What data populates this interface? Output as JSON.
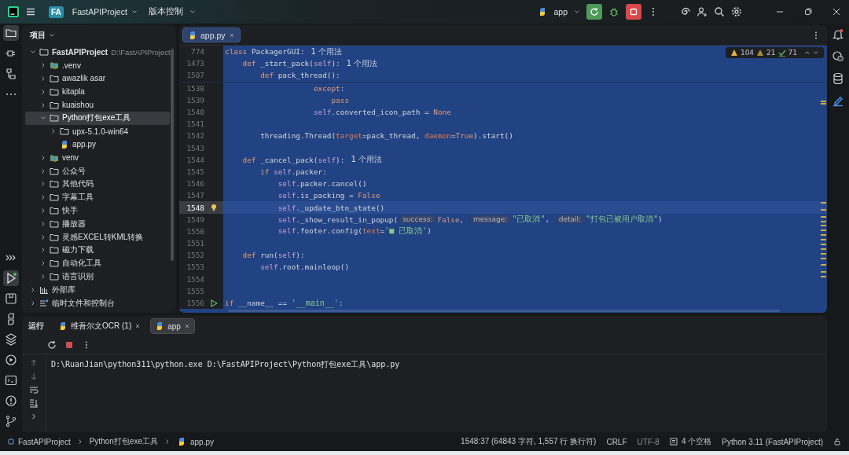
{
  "app": {
    "logo": "FA",
    "project": "FastAPIProject",
    "vcs": "版本控制",
    "run_config": "app"
  },
  "project": {
    "title": "项目",
    "tree": [
      {
        "name": "FastAPIProject",
        "path": "D:\\FastAPIProject",
        "kind": "folder",
        "expanded": true,
        "selected": false,
        "children": [
          {
            "name": ".venv",
            "kind": "venv",
            "expanded": false,
            "selected": false
          },
          {
            "name": "awazlik asar",
            "kind": "folder",
            "expanded": false,
            "selected": false
          },
          {
            "name": "kitapla",
            "kind": "folder",
            "expanded": false,
            "selected": false
          },
          {
            "name": "kuaishou",
            "kind": "folder",
            "expanded": false,
            "selected": false
          },
          {
            "name": "Python打包exe工具",
            "kind": "folder",
            "expanded": true,
            "selected": true,
            "children": [
              {
                "name": "upx-5.1.0-win64",
                "kind": "folder",
                "expanded": false,
                "selected": false
              },
              {
                "name": "app.py",
                "kind": "python",
                "selected": false
              }
            ]
          },
          {
            "name": "venv",
            "kind": "venv",
            "expanded": false,
            "selected": false
          },
          {
            "name": "公众号",
            "kind": "folder",
            "expanded": false,
            "selected": false
          },
          {
            "name": "其他代码",
            "kind": "folder",
            "expanded": false,
            "selected": false
          },
          {
            "name": "字幕工具",
            "kind": "folder",
            "expanded": false,
            "selected": false
          },
          {
            "name": "快手",
            "kind": "folder",
            "expanded": false,
            "selected": false
          },
          {
            "name": "播放器",
            "kind": "folder",
            "expanded": false,
            "selected": false
          },
          {
            "name": "灵感EXCEL转KML转换",
            "kind": "folder",
            "expanded": false,
            "selected": false
          },
          {
            "name": "磁力下载",
            "kind": "folder",
            "expanded": false,
            "selected": false
          },
          {
            "name": "自动化工具",
            "kind": "folder",
            "expanded": false,
            "selected": false
          },
          {
            "name": "语言识别",
            "kind": "folder",
            "expanded": false,
            "selected": false
          }
        ]
      },
      {
        "name": "外部库",
        "kind": "library",
        "expanded": false,
        "selected": false
      },
      {
        "name": "临时文件和控制台",
        "kind": "scratch",
        "expanded": false,
        "selected": false
      }
    ]
  },
  "editor": {
    "tabs": [
      {
        "label": "app.py",
        "selected": true
      }
    ],
    "inspections": {
      "warnings": "104",
      "weak_warnings": "21",
      "typos": "71"
    },
    "sticky_lines": [
      {
        "no": "774",
        "current": false,
        "tokens": [
          {
            "kind": "keyword",
            "text": "class "
          },
          {
            "kind": "plain",
            "text": "PackagerGUI:"
          },
          {
            "kind": "usage",
            "text": "1 个用法"
          }
        ]
      },
      {
        "no": "1473",
        "current": false,
        "tokens": [
          {
            "kind": "keyword",
            "text": "    def "
          },
          {
            "kind": "plain",
            "text": "_start_pack("
          },
          {
            "kind": "self",
            "text": "self"
          },
          {
            "kind": "plain",
            "text": "):"
          },
          {
            "kind": "usage",
            "text": "1 个用法"
          }
        ]
      },
      {
        "no": "1507",
        "current": false,
        "tokens": [
          {
            "kind": "keyword",
            "text": "        def "
          },
          {
            "kind": "plain",
            "text": "pack_thread():"
          }
        ]
      }
    ],
    "lines": [
      {
        "no": "1538",
        "current": false,
        "tokens": [
          {
            "kind": "keyword",
            "text": "                    except"
          },
          {
            "kind": "plain",
            "text": ":"
          }
        ]
      },
      {
        "no": "1539",
        "current": false,
        "tokens": [
          {
            "kind": "keyword",
            "text": "                        pass"
          }
        ]
      },
      {
        "no": "1540",
        "current": false,
        "tokens": [
          {
            "kind": "self",
            "text": "                    self"
          },
          {
            "kind": "plain",
            "text": ".converted_icon_path = "
          },
          {
            "kind": "keyword",
            "text": "None"
          }
        ]
      },
      {
        "no": "1541",
        "current": false
      },
      {
        "no": "1542",
        "current": false,
        "tokens": [
          {
            "kind": "plain",
            "text": "        threading.Thread("
          },
          {
            "kind": "param",
            "text": "target"
          },
          {
            "kind": "plain",
            "text": "=pack_thread, "
          },
          {
            "kind": "param",
            "text": "daemon"
          },
          {
            "kind": "plain",
            "text": "="
          },
          {
            "kind": "keyword",
            "text": "True"
          },
          {
            "kind": "plain",
            "text": ").start()"
          }
        ]
      },
      {
        "no": "1543",
        "current": false
      },
      {
        "no": "1544",
        "current": false,
        "tokens": [
          {
            "kind": "keyword",
            "text": "    def "
          },
          {
            "kind": "plain",
            "text": "_cancel_pack("
          },
          {
            "kind": "self",
            "text": "self"
          },
          {
            "kind": "plain",
            "text": "):"
          },
          {
            "kind": "usage",
            "text": "1 个用法"
          }
        ]
      },
      {
        "no": "1545",
        "current": false,
        "tokens": [
          {
            "kind": "keyword",
            "text": "        if "
          },
          {
            "kind": "self",
            "text": "self"
          },
          {
            "kind": "plain",
            "text": ".packer:"
          }
        ]
      },
      {
        "no": "1546",
        "current": false,
        "tokens": [
          {
            "kind": "self",
            "text": "            self"
          },
          {
            "kind": "plain",
            "text": ".packer.cancel()"
          }
        ]
      },
      {
        "no": "1547",
        "current": false,
        "tokens": [
          {
            "kind": "self",
            "text": "            self"
          },
          {
            "kind": "plain",
            "text": ".is_packing = "
          },
          {
            "kind": "keyword",
            "text": "False"
          }
        ]
      },
      {
        "no": "1548",
        "current": true,
        "kind": "bulb",
        "tokens": [
          {
            "kind": "self",
            "text": "            self"
          },
          {
            "kind": "plain",
            "text": "._update_btn_state()"
          }
        ]
      },
      {
        "no": "1549",
        "current": false,
        "tokens": [
          {
            "kind": "self",
            "text": "            self"
          },
          {
            "kind": "plain",
            "text": "._show_result_in_popup("
          },
          {
            "kind": "hint",
            "text": "success:"
          },
          {
            "kind": "keyword",
            "text": "False"
          },
          {
            "kind": "plain",
            "text": ", "
          },
          {
            "kind": "hint",
            "text": "message:"
          },
          {
            "kind": "string",
            "text": "\"已取消\""
          },
          {
            "kind": "plain",
            "text": ", "
          },
          {
            "kind": "hint",
            "text": "detail:"
          },
          {
            "kind": "string",
            "text": "\"打包已被用户取消\""
          },
          {
            "kind": "plain",
            "text": ")"
          }
        ]
      },
      {
        "no": "1550",
        "current": false,
        "tokens": [
          {
            "kind": "self",
            "text": "            self"
          },
          {
            "kind": "plain",
            "text": ".footer.config("
          },
          {
            "kind": "param",
            "text": "text"
          },
          {
            "kind": "plain",
            "text": "="
          },
          {
            "kind": "string",
            "text": "'■ 已取消'"
          },
          {
            "kind": "plain",
            "text": ")"
          }
        ]
      },
      {
        "no": "1551",
        "current": false
      },
      {
        "no": "1552",
        "current": false,
        "tokens": [
          {
            "kind": "keyword",
            "text": "    def "
          },
          {
            "kind": "plain",
            "text": "run("
          },
          {
            "kind": "self",
            "text": "self"
          },
          {
            "kind": "plain",
            "text": "):"
          }
        ]
      },
      {
        "no": "1553",
        "current": false,
        "tokens": [
          {
            "kind": "self",
            "text": "        self"
          },
          {
            "kind": "plain",
            "text": ".root.mainloop()"
          }
        ]
      },
      {
        "no": "1554",
        "current": false
      },
      {
        "no": "1555",
        "current": false
      },
      {
        "no": "1556",
        "current": false,
        "kind": "run",
        "tokens": [
          {
            "kind": "keyword",
            "text": "if "
          },
          {
            "kind": "plain",
            "text": "__name__ == "
          },
          {
            "kind": "string",
            "text": "'__main__'"
          },
          {
            "kind": "plain",
            "text": ":"
          }
        ]
      }
    ]
  },
  "run": {
    "title": "运行",
    "tabs": [
      {
        "label": "维吾尔文OCR (1)",
        "selected": false
      },
      {
        "label": "app",
        "selected": true
      }
    ],
    "output": "D:\\RuanJian\\python311\\python.exe D:\\FastAPIProject\\Python打包exe工具\\app.py"
  },
  "status_bar": {
    "breadcrumbs": [
      "FastAPIProject",
      "Python打包exe工具",
      "app.py"
    ],
    "position": "1548:37 (64843 字符, 1,557 行 换行符)",
    "line_separator": "CRLF",
    "encoding": "UTF-8",
    "indent": "4 个空格",
    "interpreter": "Python 3.11 (FastAPIProject)"
  }
}
